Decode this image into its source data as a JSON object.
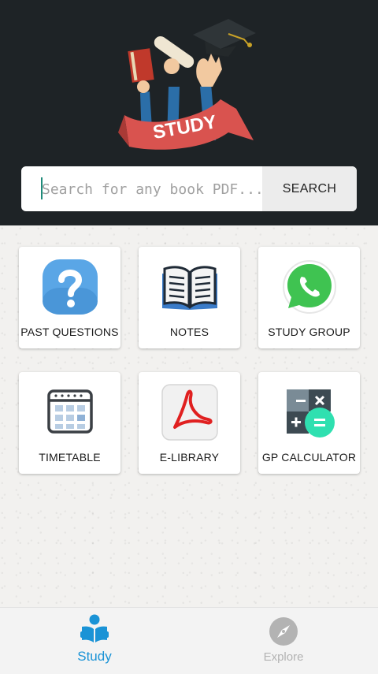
{
  "header": {
    "logo_text": "STUDY"
  },
  "search": {
    "placeholder": "Search for any book PDF...",
    "value": "",
    "button_label": "SEARCH"
  },
  "tiles": [
    {
      "label": "PAST QUESTIONS",
      "icon": "question-icon"
    },
    {
      "label": "NOTES",
      "icon": "open-book-icon"
    },
    {
      "label": "STUDY GROUP",
      "icon": "whatsapp-icon"
    },
    {
      "label": "TIMETABLE",
      "icon": "calendar-icon"
    },
    {
      "label": "E-LIBRARY",
      "icon": "pdf-icon"
    },
    {
      "label": "GP CALCULATOR",
      "icon": "calculator-icon"
    }
  ],
  "bottom_nav": {
    "items": [
      {
        "label": "Study",
        "icon": "reader-icon",
        "active": true
      },
      {
        "label": "Explore",
        "icon": "compass-icon",
        "active": false
      }
    ]
  },
  "colors": {
    "header_bg": "#1e2326",
    "active_tab": "#1a93d6",
    "inactive_tab": "#b3b3b3",
    "ribbon": "#d9534f"
  }
}
